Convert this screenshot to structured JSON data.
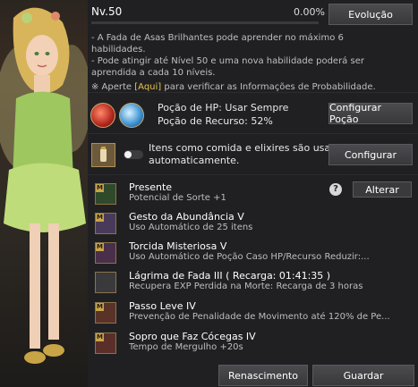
{
  "header": {
    "level": "Nv.50",
    "progress": "0.00%",
    "evolution_button": "Evolução"
  },
  "info": {
    "line1": "- A Fada de Asas Brilhantes pode aprender no máximo 6 habilidades.",
    "line2": "- Pode atingir até Nível 50 e uma nova habilidade poderá ser aprendida a cada 10 níveis.",
    "note_prefix": "※ Aperte ",
    "note_link": "[Aqui]",
    "note_suffix": " para verificar as Informações de Probabilidade."
  },
  "potion": {
    "hp_line": "Poção de HP: Usar Sempre",
    "resource_line": "Poção de Recurso: 52%",
    "configure_button": "Configurar Poção"
  },
  "auto_use": {
    "text_line1": "Itens como comida e elixires são usados",
    "text_line2": "automaticamente.",
    "configure_button": "Configurar",
    "toggle_on": false
  },
  "change_button": "Alterar",
  "help_glyph": "?",
  "skills": [
    {
      "name": "Presente",
      "desc": "Potencial de Sorte +1",
      "icon": "clover-icon",
      "badge": "M"
    },
    {
      "name": "Gesto da Abundância V",
      "desc": "Uso Automático de 25 itens",
      "icon": "fairy-gesture-icon",
      "badge": "M"
    },
    {
      "name": "Torcida Misteriosa V",
      "desc": "Uso Automático de Poção Caso HP/Recurso Reduzir:...",
      "icon": "potion-cheer-icon",
      "badge": "M"
    },
    {
      "name": "Lágrima de Fada III  ( Recarga: 01:41:35 )",
      "desc": "Recupera EXP Perdida na Morte: Recarga de 3 horas",
      "icon": "fairy-tear-icon",
      "badge": ""
    },
    {
      "name": "Passo Leve IV",
      "desc": "Prevenção de Penalidade de Movimento até 120% de Pe...",
      "icon": "light-step-icon",
      "badge": "M"
    },
    {
      "name": "Sopro que Faz Cócegas IV",
      "desc": "Tempo de Mergulho +20s",
      "icon": "tickle-breath-icon",
      "badge": "M"
    }
  ],
  "footer": {
    "rebirth_button": "Renascimento",
    "save_button": "Guardar"
  },
  "colors": {
    "accent_link": "#e6c44a",
    "panel_bg": "#202023"
  }
}
